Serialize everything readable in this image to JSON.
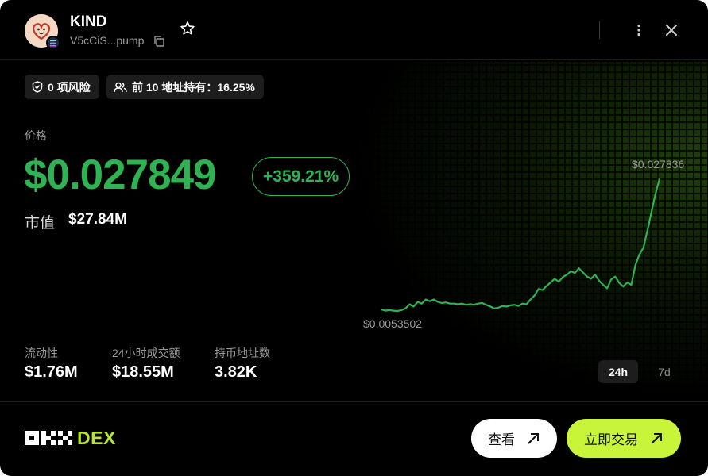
{
  "token": {
    "name": "KIND",
    "address": "V5cCiS...pump",
    "avatar_icon": "heart-avatar",
    "chain_icon": "solana-icon"
  },
  "tags": {
    "risk": "0 项风险",
    "holders": "前 10 地址持有：16.25%"
  },
  "price": {
    "label": "价格",
    "value": "$0.027849",
    "change": "+359.21%",
    "change_color": "#2fb252"
  },
  "market_cap": {
    "label": "市值",
    "value": "$27.84M"
  },
  "stats": [
    {
      "label": "流动性",
      "value": "$1.76M"
    },
    {
      "label": "24小时成交额",
      "value": "$18.55M"
    },
    {
      "label": "持币地址数",
      "value": "3.82K"
    }
  ],
  "chart_data": {
    "type": "line",
    "high_label": "$0.027836",
    "low_label": "$0.0053502",
    "ylim": [
      0.0053502,
      0.027836
    ],
    "series": [
      {
        "color": "#2fb252",
        "values": [
          0.0056,
          0.0054,
          0.0055,
          0.0054,
          0.0053502,
          0.0055,
          0.0058,
          0.0065,
          0.0061,
          0.0069,
          0.0066,
          0.0073,
          0.007,
          0.0073,
          0.0069,
          0.0067,
          0.0068,
          0.0066,
          0.0066,
          0.0065,
          0.0066,
          0.0064,
          0.0065,
          0.0064,
          0.0066,
          0.0067,
          0.0064,
          0.0061,
          0.0058,
          0.0059,
          0.0062,
          0.0061,
          0.0063,
          0.0064,
          0.0062,
          0.0066,
          0.0065,
          0.0073,
          0.008,
          0.0091,
          0.0089,
          0.0096,
          0.0102,
          0.0108,
          0.0103,
          0.0111,
          0.0115,
          0.0121,
          0.0118,
          0.0126,
          0.0119,
          0.0112,
          0.0108,
          0.0115,
          0.0105,
          0.0098,
          0.0092,
          0.0107,
          0.0112,
          0.0101,
          0.0095,
          0.0102,
          0.0098,
          0.0131,
          0.0149,
          0.0161,
          0.019,
          0.0222,
          0.0252,
          0.0278
        ]
      }
    ],
    "grid": true
  },
  "ranges": {
    "selected": "24h",
    "other": "7d"
  },
  "footer": {
    "brand": "DEX",
    "view_label": "查看",
    "trade_label": "立即交易",
    "trade_color": "#c8f53a"
  }
}
